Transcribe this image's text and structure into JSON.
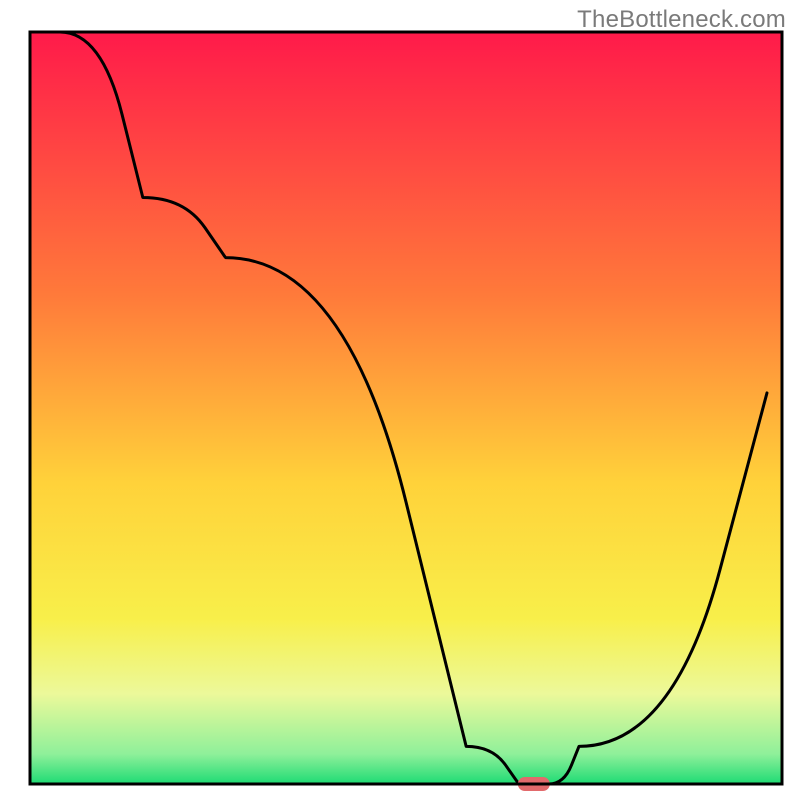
{
  "watermark": "TheBottleneck.com",
  "chart_data": {
    "type": "line",
    "title": "",
    "xlabel": "",
    "ylabel": "",
    "xlim": [
      0,
      100
    ],
    "ylim": [
      0,
      100
    ],
    "x": [
      4,
      15,
      26,
      58,
      65,
      69,
      73,
      98
    ],
    "values": [
      100,
      78,
      70,
      5,
      0,
      0,
      5,
      52
    ],
    "marker": {
      "x": 67,
      "y": 0,
      "color": "#e26a6c"
    },
    "gradient_stops": [
      {
        "offset": 0,
        "color": "#ff1a4a"
      },
      {
        "offset": 35,
        "color": "#ff7a3a"
      },
      {
        "offset": 60,
        "color": "#ffd23a"
      },
      {
        "offset": 78,
        "color": "#f8ef4a"
      },
      {
        "offset": 88,
        "color": "#ecf99a"
      },
      {
        "offset": 96,
        "color": "#8ff09a"
      },
      {
        "offset": 100,
        "color": "#1edb74"
      }
    ],
    "axes_visible": false,
    "legend": null
  }
}
